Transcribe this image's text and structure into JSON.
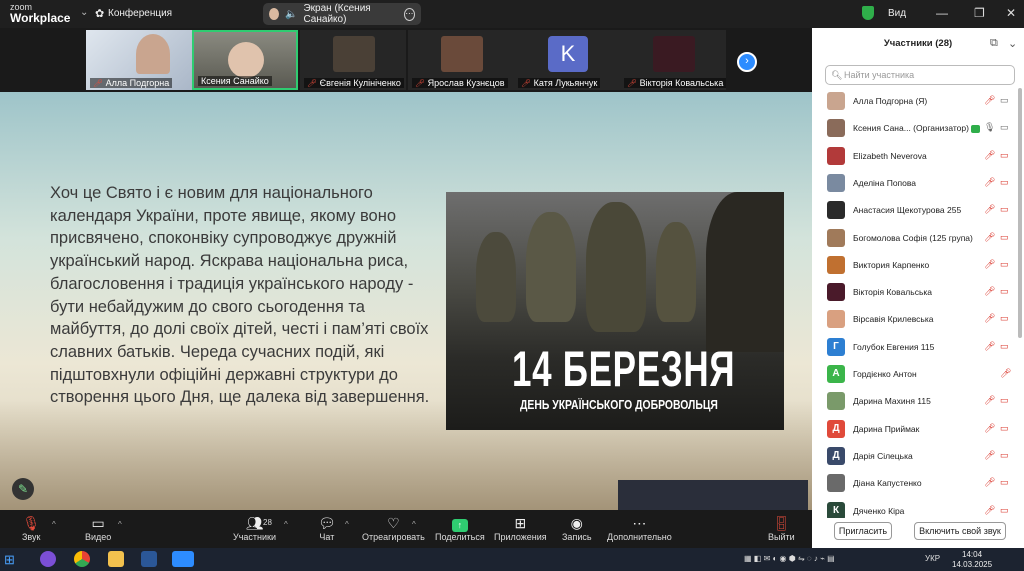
{
  "app": {
    "logo_line1": "zoom",
    "logo_line2": "Workplace",
    "conference_label": "Конференция",
    "screen_share_label": "Экран (Ксения Санайко)",
    "view_label": "Вид"
  },
  "thumbs": [
    {
      "name": "Алла Подгорна",
      "muted": true
    },
    {
      "name": "Ксения Санайко",
      "muted": false,
      "active": true
    },
    {
      "name": "Євгенія Кулініченко",
      "muted": true
    },
    {
      "name": "Ярослав Кузнєцов",
      "muted": true
    },
    {
      "name": "Катя Лукьянчук",
      "muted": true,
      "initial": "K"
    },
    {
      "name": "Вікторія Ковальська",
      "muted": true
    }
  ],
  "slide": {
    "text": "Хоч це Свято і є новим для національного календаря України, проте явище, якому воно присвячено, споконвіку супроводжує дружній український народ. Яскрава національна риса, благословення і традиція українського народу - бути небайдужим до свого сьогодення та майбуття, до долі своїх дітей, честі і пам’яті своїх славних батьків. Череда сучасних подій, які підштовхнули офіційні державні структури до створення цього Дня, ще далека від завершення.",
    "poster_title": "14 БЕРЕЗНЯ",
    "poster_subtitle": "ДЕНЬ УКРАЇНСЬКОГО ДОБРОВОЛЬЦЯ"
  },
  "toolbar": {
    "audio": "Звук",
    "video": "Видео",
    "participants": "Участники",
    "participants_count": "28",
    "chat": "Чат",
    "react": "Отреагировать",
    "share": "Поделиться",
    "apps": "Приложения",
    "record": "Запись",
    "more": "Дополнительно",
    "leave": "Выйти"
  },
  "panel": {
    "title": "Участники (28)",
    "search_placeholder": "Найти участника",
    "invite": "Пригласить",
    "unmute": "Включить свой звук",
    "participants": [
      {
        "name": "Алла Подгорна (Я)",
        "avatar": "photo",
        "color": "#c9a58f",
        "video_off": false
      },
      {
        "name": "Ксения Сана... (Организатор)",
        "avatar": "photo",
        "color": "#8a6b5a",
        "organizer": true,
        "video_off": false
      },
      {
        "name": "Elizabeth Neverova",
        "avatar": "photo",
        "color": "#b23a3a",
        "video_off": true
      },
      {
        "name": "Аделіна Попова",
        "avatar": "photo",
        "color": "#7a8aa0",
        "video_off": true
      },
      {
        "name": "Анастасия Щекотурова 255",
        "avatar": "photo",
        "color": "#2a2a2a",
        "video_off": true
      },
      {
        "name": "Богомолова Софія (125 група)",
        "avatar": "photo",
        "color": "#a07a5a",
        "video_off": true
      },
      {
        "name": "Виктория Карпенко",
        "avatar": "photo",
        "color": "#c07030",
        "video_off": true
      },
      {
        "name": "Вікторія Ковальська",
        "avatar": "photo",
        "color": "#4a1a2a",
        "video_off": true
      },
      {
        "name": "Вірсавія Крилевська",
        "avatar": "photo",
        "color": "#d9a080",
        "video_off": true
      },
      {
        "name": "Голубок Евгения 115",
        "avatar": "letter",
        "initial": "Г",
        "color": "#2d7fd2",
        "video_off": true
      },
      {
        "name": "Гордієнко Антон",
        "avatar": "letter",
        "initial": "А",
        "color": "#3bb54a",
        "video_off": false,
        "no_video_icon": true
      },
      {
        "name": "Дарина Махиня 115",
        "avatar": "photo",
        "color": "#7a9a6a",
        "video_off": true
      },
      {
        "name": "Дарина Приймак",
        "avatar": "letter",
        "initial": "Д",
        "color": "#e04a3a",
        "video_off": true
      },
      {
        "name": "Дарія Сілецька",
        "avatar": "letter",
        "initial": "Д",
        "color": "#3a4a6a",
        "video_off": true
      },
      {
        "name": "Діана Капустенко",
        "avatar": "photo",
        "color": "#6a6a6a",
        "video_off": true
      },
      {
        "name": "Дяченко Кіра",
        "avatar": "letter",
        "initial": "К",
        "color": "#2a4a3a",
        "video_off": true
      }
    ]
  },
  "taskbar": {
    "lang": "УКР",
    "time": "14:04",
    "date": "14.03.2025"
  },
  "colors": {
    "accent": "#2d8cff",
    "green": "#2fcc71",
    "mute_red": "#d93025"
  }
}
